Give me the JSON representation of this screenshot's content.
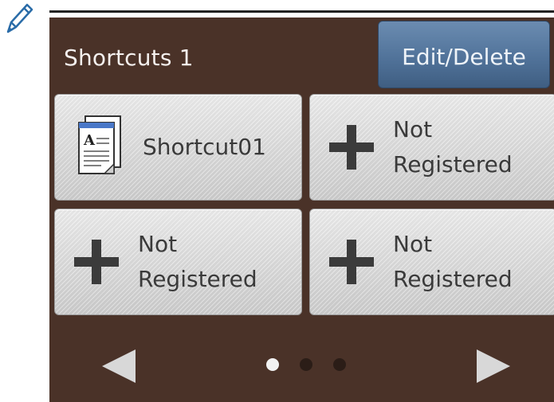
{
  "header": {
    "title": "Shortcuts 1",
    "edit_label": "Edit/Delete"
  },
  "tiles": [
    {
      "label": "Shortcut01",
      "icon": "copy-document-icon"
    },
    {
      "label_line1": "Not",
      "label_line2": "Registered",
      "icon": "plus-icon"
    },
    {
      "label_line1": "Not",
      "label_line2": "Registered",
      "icon": "plus-icon"
    },
    {
      "label_line1": "Not",
      "label_line2": "Registered",
      "icon": "plus-icon"
    }
  ],
  "pager": {
    "pages": 3,
    "current": 1
  },
  "colors": {
    "screen_bg": "#4a3228",
    "button_blue": "#51739a",
    "tile_gray": "#d9d9d9"
  }
}
